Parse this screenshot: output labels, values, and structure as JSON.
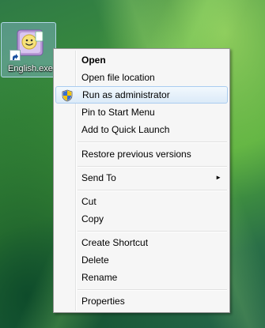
{
  "desktop": {
    "shortcut": {
      "label": "English.exe",
      "icon": "smiley-app-icon"
    }
  },
  "context_menu": {
    "items": [
      {
        "label": "Open",
        "bold": true
      },
      {
        "label": "Open file location"
      },
      {
        "label": "Run as administrator",
        "icon": "uac-shield-icon",
        "highlighted": true
      },
      {
        "label": "Pin to Start Menu"
      },
      {
        "label": "Add to Quick Launch"
      },
      {
        "label": "Restore previous versions"
      },
      {
        "label": "Send To",
        "submenu": true
      },
      {
        "label": "Cut"
      },
      {
        "label": "Copy"
      },
      {
        "label": "Create Shortcut"
      },
      {
        "label": "Delete"
      },
      {
        "label": "Rename"
      },
      {
        "label": "Properties"
      }
    ],
    "submenu_arrow": "►"
  },
  "colors": {
    "highlight_border": "#aaccf0",
    "menu_background": "#f6f6f6"
  }
}
